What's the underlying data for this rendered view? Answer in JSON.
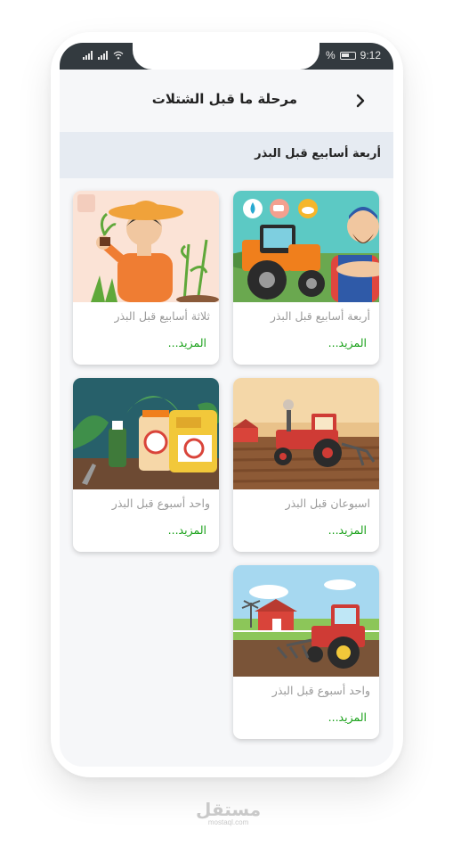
{
  "status": {
    "time": "9:12",
    "battery_text": "%"
  },
  "header": {
    "title": "مرحلة ما قبل الشتلات"
  },
  "section": {
    "label": "أربعة أسابيع قبل البذر"
  },
  "cards": [
    {
      "title": "أربعة أسابيع قبل البذر",
      "more": "المزيد..."
    },
    {
      "title": "ثلاثة أسابيع قبل البذر",
      "more": "المزيد..."
    },
    {
      "title": "اسبوعان قبل البذر",
      "more": "المزيد..."
    },
    {
      "title": "واحد أسبوع قبل البذر",
      "more": "المزيد..."
    },
    {
      "title": "واحد أسبوع قبل البذر",
      "more": "المزيد..."
    }
  ],
  "watermark": {
    "ar": "مستقل",
    "en": "mostaql.com"
  },
  "colors": {
    "accent_green": "#1aa11a",
    "statusbar": "#333a3f",
    "section_band": "#e6ebf2"
  }
}
